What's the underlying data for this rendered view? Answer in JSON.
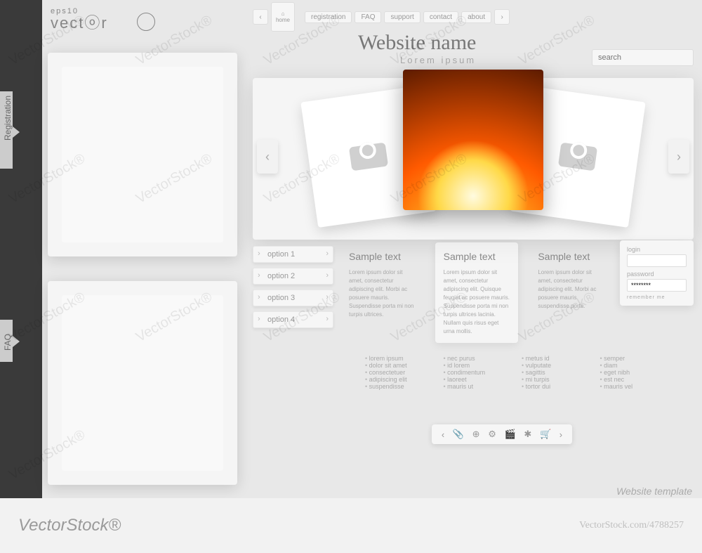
{
  "eps_label": "vectⓞr",
  "eps_small": "eps10",
  "side_tabs": {
    "reg": "Registration",
    "faq": "FAQ"
  },
  "home_label": "home",
  "nav": {
    "items": [
      "registration",
      "FAQ",
      "support",
      "contact",
      "about"
    ]
  },
  "site": {
    "title": "Website name",
    "subtitle": "Lorem ipsum"
  },
  "search": {
    "placeholder": "search"
  },
  "options": [
    "option 1",
    "option 2",
    "option 3",
    "option 4"
  ],
  "columns": [
    {
      "title": "Sample text",
      "body": "Lorem ipsum dolor sit amet, consectetur adipiscing elit. Morbi ac posuere mauris. Suspendisse porta mi non turpis ultrices."
    },
    {
      "title": "Sample text",
      "body": "Lorem ipsum dolor sit amet, consectetur adipiscing elit. Quisque feugiat ac posuere mauris. Suspendisse porta mi non turpis ultrices lacinia. Nullam quis risus eget urna mollis."
    },
    {
      "title": "Sample text",
      "body": "Lorem ipsum dolor sit amet, consectetur adipiscing elit. Morbi ac posuere mauris suspendisse porta."
    }
  ],
  "login": {
    "login_label": "login",
    "password_label": "password",
    "value": "********",
    "remember": "remember me"
  },
  "footer_lists": [
    [
      "lorem ipsum",
      "dolor sit amet",
      "consectetuer",
      "adipiscing elit",
      "suspendisse"
    ],
    [
      "nec purus",
      "id lorem",
      "condimentum",
      "laoreet",
      "mauris ut"
    ],
    [
      "metus id",
      "vulputate",
      "sagittis",
      "mi turpis",
      "tortor dui"
    ],
    [
      "semper",
      "diam",
      "eget nibh",
      "est nec",
      "mauris vel"
    ]
  ],
  "toolbar_icons": [
    "‹",
    "📎",
    "⊕",
    "⚙",
    "🎬",
    "✱",
    "🛒",
    "›"
  ],
  "template_label": "Website template",
  "brand": "VectorStock®",
  "stock_id": "VectorStock.com/4788257",
  "watermark": "VectorStock®"
}
